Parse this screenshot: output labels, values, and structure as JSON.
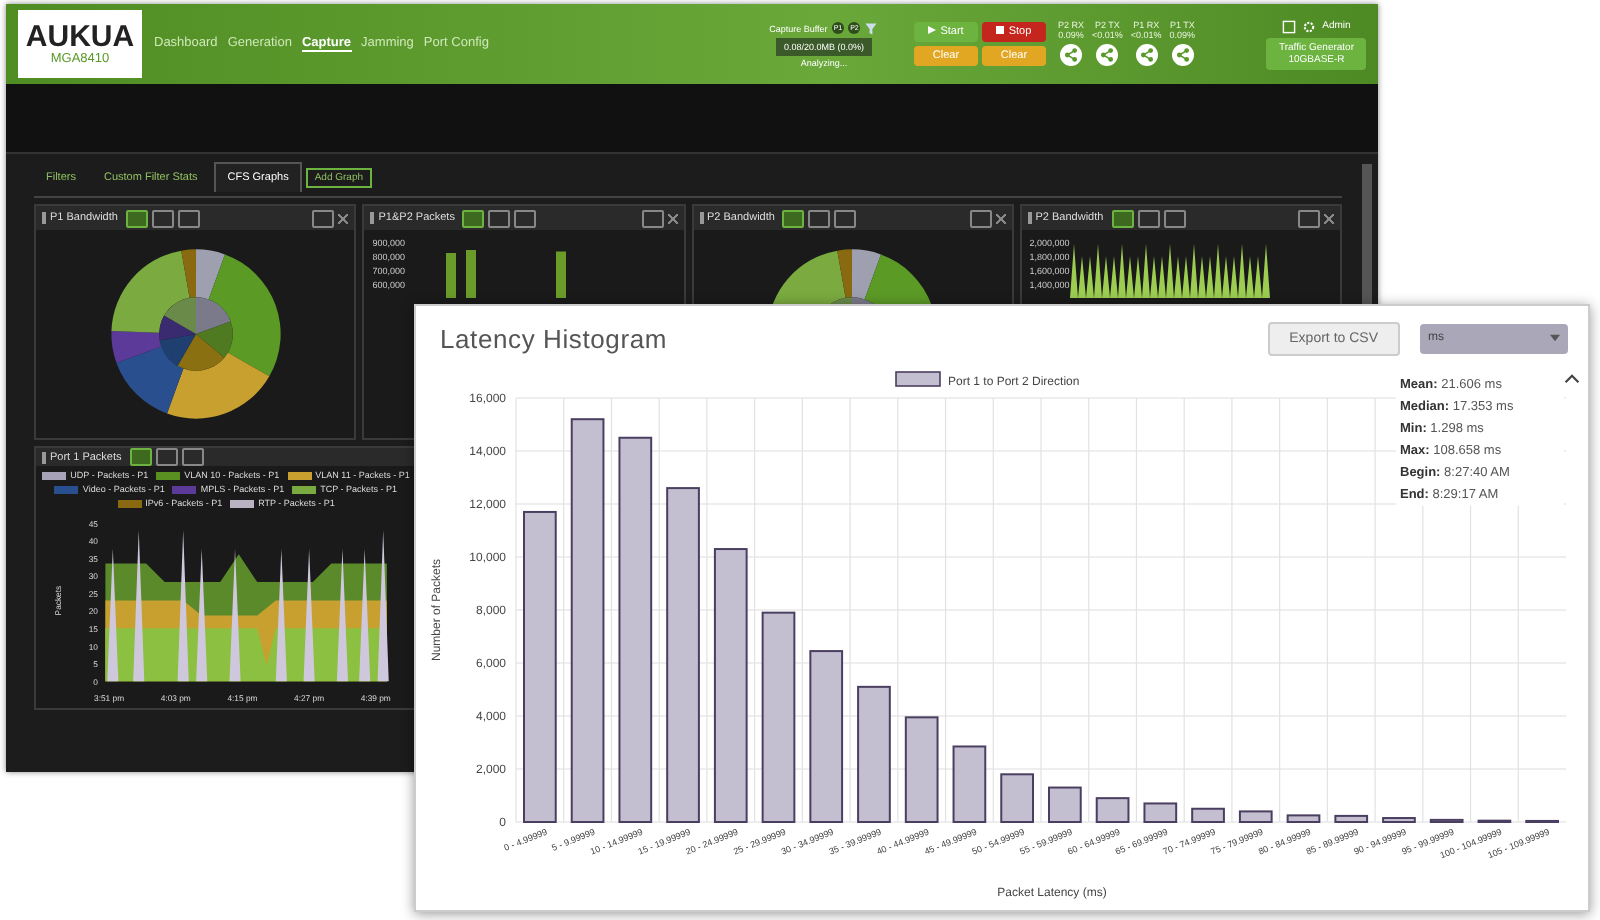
{
  "header": {
    "logo": "AUKUA",
    "model": "MGA8410",
    "nav": [
      {
        "label": "Dashboard",
        "selected": false
      },
      {
        "label": "Generation",
        "selected": false
      },
      {
        "label": "Capture",
        "selected": true
      },
      {
        "label": "Jamming",
        "selected": false
      },
      {
        "label": "Port Config",
        "selected": false
      }
    ],
    "capture_buffer": {
      "label": "Capture Buffer",
      "ports": [
        "P1",
        "P2"
      ],
      "value": "0.08/20.0MB (0.0%)",
      "status": "Analyzing..."
    },
    "buttons": [
      {
        "label": "Start",
        "kind": "start"
      },
      {
        "label": "Stop",
        "kind": "stop"
      },
      {
        "label": "Clear",
        "kind": "clear-save"
      },
      {
        "label": "Clear",
        "kind": "clear-alarm"
      }
    ],
    "port_stats": [
      {
        "label": "P2 RX",
        "value": "0.09%"
      },
      {
        "label": "P2 TX",
        "value": "<0.01%"
      },
      {
        "label": "P1 RX",
        "value": "<0.01%"
      },
      {
        "label": "P1 TX",
        "value": "0.09%"
      }
    ],
    "user": "Admin",
    "traffic_generator": {
      "title": "Traffic Generator",
      "mode": "10GBASE-R"
    }
  },
  "tabs": [
    {
      "label": "Filters",
      "selected": false
    },
    {
      "label": "Custom Filter Stats",
      "selected": false
    },
    {
      "label": "CFS Graphs",
      "selected": true
    }
  ],
  "add_graph": "Add Graph",
  "panels": [
    {
      "title": "P1 Bandwidth",
      "kind": "donut"
    },
    {
      "title": "P1&P2 Packets",
      "kind": "bars",
      "y_ticks": [
        "900,000",
        "800,000",
        "700,000",
        "600,000"
      ]
    },
    {
      "title": "P2 Bandwidth",
      "kind": "donut"
    },
    {
      "title": "P2 Bandwidth",
      "kind": "spikes",
      "y_ticks": [
        "2,000,000",
        "1,800,000",
        "1,600,000",
        "1,400,000"
      ]
    }
  ],
  "port_panel": {
    "title": "Port 1 Packets",
    "legend": [
      {
        "label": "UDP - Packets - P1",
        "color": "#a8a2b8"
      },
      {
        "label": "VLAN 10 - Packets - P1",
        "color": "#5a8f22"
      },
      {
        "label": "VLAN 11 - Packets - P1",
        "color": "#c8a030"
      },
      {
        "label": "Video - Packets - P1",
        "color": "#2a4f8f"
      },
      {
        "label": "MPLS - Packets - P1",
        "color": "#5b3a9a"
      },
      {
        "label": "TCP - Packets - P1",
        "color": "#7aaa40"
      },
      {
        "label": "IPv6 - Packets - P1",
        "color": "#8a6a10"
      },
      {
        "label": "RTP - Packets - P1",
        "color": "#b8b2c2"
      }
    ],
    "y_axis_title": "Packets",
    "y_ticks": [
      "45",
      "40",
      "35",
      "30",
      "25",
      "20",
      "15",
      "10",
      "5",
      "0"
    ],
    "x_ticks": [
      "3:51 pm",
      "4:03 pm",
      "4:15 pm",
      "4:27 pm",
      "4:39 pm"
    ]
  },
  "histogram": {
    "title": "Latency Histogram",
    "export": "Export to CSV",
    "unit": "ms",
    "stats": [
      {
        "label": "Mean:",
        "value": "21.606 ms"
      },
      {
        "label": "Median:",
        "value": "17.353 ms"
      },
      {
        "label": "Min:",
        "value": "1.298 ms"
      },
      {
        "label": "Max:",
        "value": "108.658 ms"
      },
      {
        "label": "Begin:",
        "value": "8:27:40 AM"
      },
      {
        "label": "End:",
        "value": "8:29:17 AM"
      }
    ],
    "expanded": true,
    "chart_data": {
      "type": "bar",
      "xlabel": "Packet Latency (ms)",
      "ylabel": "Number of Packets",
      "categories": [
        "0 - 4.99999",
        "5 - 9.99999",
        "10 - 14.99999",
        "15 - 19.99999",
        "20 - 24.99999",
        "25 - 29.99999",
        "30 - 34.99999",
        "35 - 39.99999",
        "40 - 44.99999",
        "45 - 49.99999",
        "50 - 54.99999",
        "55 - 59.99999",
        "60 - 64.99999",
        "65 - 69.99999",
        "70 - 74.99999",
        "75 - 79.99999",
        "80 - 84.99999",
        "85 - 89.99999",
        "90 - 94.99999",
        "95 - 99.99999",
        "100 - 104.99999",
        "105 - 109.99999"
      ],
      "series": [
        {
          "name": "Port 1 to Port 2 Direction",
          "color": "#c4bfd0",
          "values": [
            11700,
            15200,
            14500,
            12600,
            10300,
            7900,
            6450,
            5100,
            3950,
            2850,
            1800,
            1300,
            900,
            700,
            500,
            400,
            250,
            230,
            150,
            80,
            50,
            40
          ]
        }
      ],
      "ylim": [
        0,
        16000
      ],
      "grid": true,
      "yticks": [
        {
          "value": 0,
          "label": "0"
        },
        {
          "value": 2000,
          "label": "2,000"
        },
        {
          "value": 4000,
          "label": "4,000"
        },
        {
          "value": 6000,
          "label": "6,000"
        },
        {
          "value": 8000,
          "label": "8,000"
        },
        {
          "value": 10000,
          "label": "10,000"
        },
        {
          "value": 12000,
          "label": "12,000"
        },
        {
          "value": 14000,
          "label": "14,000"
        },
        {
          "value": 16000,
          "label": "16,000"
        }
      ]
    }
  }
}
